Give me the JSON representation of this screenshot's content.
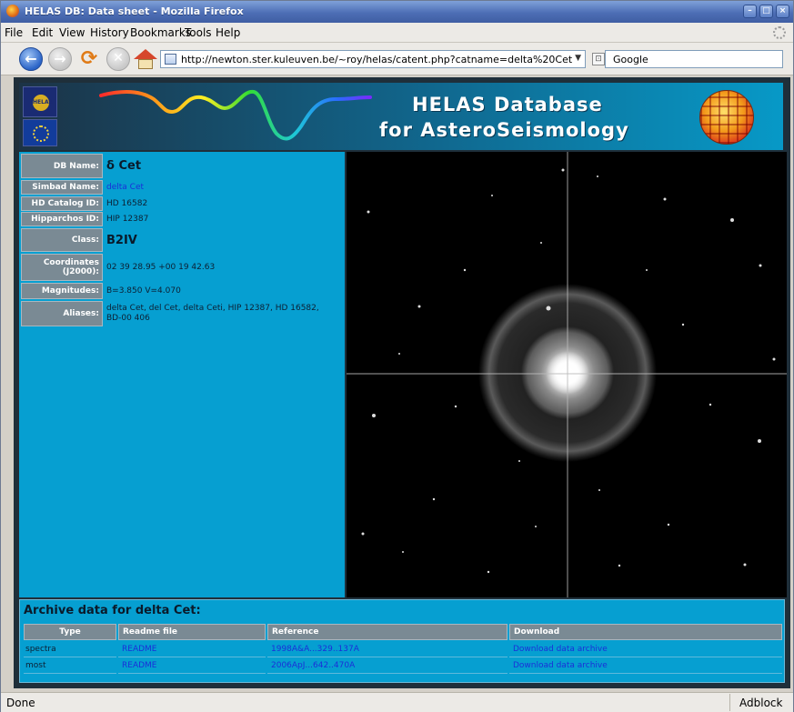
{
  "window": {
    "title": "HELAS DB: Data sheet - Mozilla Firefox"
  },
  "menu": [
    "File",
    "Edit",
    "View",
    "History",
    "Bookmarks",
    "Tools",
    "Help"
  ],
  "nav": {
    "url": "http://newton.ster.kuleuven.be/~roy/helas/catent.php?catname=delta%20Cet",
    "search_engine": "Google"
  },
  "banner": {
    "logo_text": "HELAS",
    "title_line1": "HELAS Database",
    "title_line2": "for AsteroSeismology"
  },
  "datasheet": {
    "db_name_label": "DB Name:",
    "db_name_value": "δ Cet",
    "simbad_label": "Simbad Name:",
    "simbad_value": "delta Cet",
    "hd_label": "HD Catalog ID:",
    "hd_value": "HD 16582",
    "hip_label": "Hipparchos ID:",
    "hip_value": "HIP 12387",
    "class_label": "Class:",
    "class_value": "B2IV",
    "coord_label": "Coordinates (J2000):",
    "coord_value": "02 39 28.95 +00 19 42.63",
    "mag_label": "Magnitudes:",
    "mag_value": "B=3.850  V=4.070",
    "alias_label": "Aliases:",
    "alias_value": "delta Cet, del Cet, delta Ceti, HIP 12387, HD 16582, BD-00 406"
  },
  "archive": {
    "heading": "Archive data for delta Cet:",
    "columns": [
      "Type",
      "Readme file",
      "Reference",
      "Download"
    ],
    "rows": [
      {
        "type": "spectra",
        "readme": "README",
        "reference": "1998A&A...329..137A",
        "download": "Download data archive"
      },
      {
        "type": "most",
        "readme": "README",
        "reference": "2006ApJ...642..470A",
        "download": "Download data archive"
      }
    ]
  },
  "status": {
    "text": "Done",
    "addon": "Adblock"
  },
  "colors": {
    "panel": "#069fd1",
    "label_bg": "#7a8a94",
    "link": "#1b2fd8",
    "titlebar": "#4d6eb5"
  }
}
